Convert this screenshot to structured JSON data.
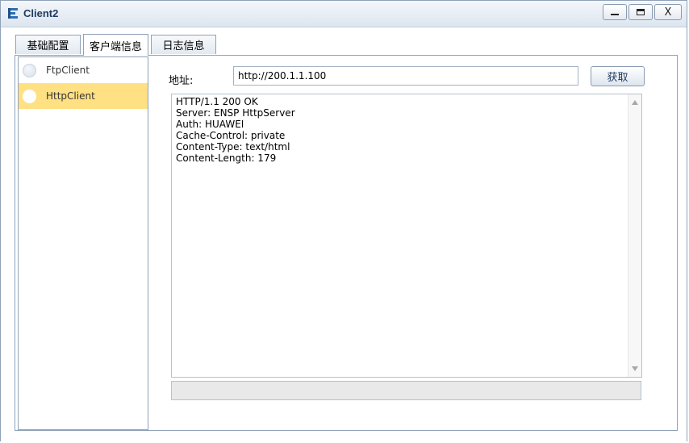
{
  "window": {
    "title": "Client2",
    "minimize": "",
    "maximize": "",
    "close": "X"
  },
  "tabs": [
    {
      "label": "基础配置"
    },
    {
      "label": "客户端信息"
    },
    {
      "label": "日志信息"
    }
  ],
  "sidebar": {
    "items": [
      {
        "label": "FtpClient",
        "selected": false
      },
      {
        "label": "HttpClient",
        "selected": true
      }
    ]
  },
  "form": {
    "address_label": "地址:",
    "address_value": "http://200.1.1.100",
    "fetch_button": "获取"
  },
  "response": {
    "text": "HTTP/1.1 200 OK\nServer: ENSP HttpServer\nAuth: HUAWEI\nCache-Control: private\nContent-Type: text/html\nContent-Length: 179"
  },
  "colors": {
    "selected_item": "#ffe083",
    "border": "#8fa2b8",
    "title": "#1e3a5f"
  }
}
